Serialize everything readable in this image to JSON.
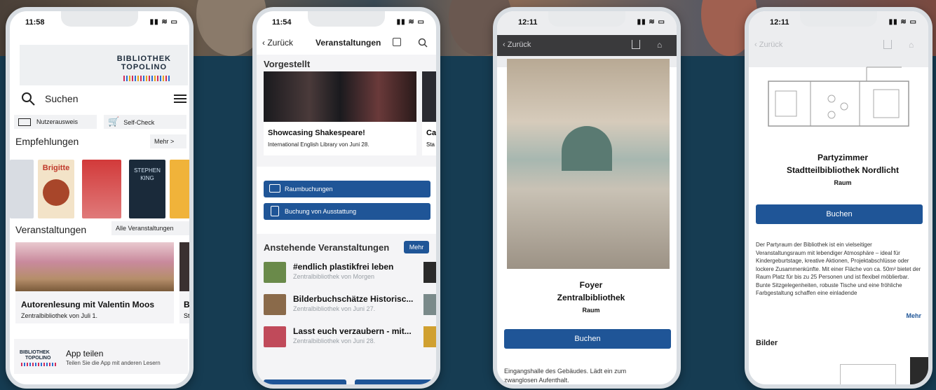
{
  "phone1": {
    "time": "11:58",
    "logo": {
      "line1": "BIBLIOTHEK",
      "line2": "TOPOLINO"
    },
    "search_label": "Suchen",
    "buttons": {
      "card": "Nutzerausweis",
      "selfcheck": "Self-Check"
    },
    "recommendations": {
      "title": "Empfehlungen",
      "more": "Mehr >"
    },
    "books": [
      {
        "title": "Brigitte",
        "color": "#c8702c"
      },
      {
        "title": "STEPHEN KING",
        "color": "#1a2a3a"
      }
    ],
    "events": {
      "title": "Veranstaltungen",
      "all": "Alle Veranstaltungen"
    },
    "event_card": {
      "title": "Autorenlesung mit Valentin Moos",
      "subtitle": "Zentralbibliothek von Juli 1.",
      "next_initial": "B",
      "next_sub": "St"
    },
    "share": {
      "logo1": "BIBLIOTHEK",
      "logo2": "TOPOLINO",
      "title": "App teilen",
      "subtitle": "Teilen Sie die App mit anderen Lesern"
    }
  },
  "phone2": {
    "time": "11:54",
    "back": "Zurück",
    "title": "Veranstaltungen",
    "featured": "Vorgestellt",
    "featured_card": {
      "title": "Showcasing Shakespeare!",
      "subtitle": "International English Library von Juni 28.",
      "next_title": "Ca",
      "next_sub": "Sta"
    },
    "buttons": {
      "rooms": "Raumbuchungen",
      "equipment": "Buchung von Ausstattung"
    },
    "upcoming": {
      "title": "Anstehende Veranstaltungen",
      "more": "Mehr"
    },
    "items": [
      {
        "title": "#endlich plastikfrei leben",
        "subtitle": "Zentralbibliothek von Morgen"
      },
      {
        "title": "Bilderbuchschätze Historisc...",
        "subtitle": "Zentralbibliothek von Juni 27."
      },
      {
        "title": "Lasst euch verzaubern - mit...",
        "subtitle": "Zentralbibliothek von Juni 28."
      }
    ]
  },
  "phone3": {
    "time": "12:11",
    "back": "Zurück",
    "room_title1": "Foyer",
    "room_title2": "Zentralbibliothek",
    "kind": "Raum",
    "book_button": "Buchen",
    "description": "Eingangshalle des Gebäudes. Lädt ein zum zwanglosen Aufenthalt."
  },
  "phone4": {
    "time": "12:11",
    "back": "Zurück",
    "room_title1": "Partyzimmer",
    "room_title2": "Stadtteilbibliothek Nordlicht",
    "kind": "Raum",
    "book_button": "Buchen",
    "description": "Der Partyraum der Bibliothek ist ein vielseitiger Veranstaltungsraum mit lebendiger Atmosphäre – ideal für Kindergeburtstage, kreative Aktionen, Projektabschlüsse oder lockere Zusammenkünfte. Mit einer Fläche von ca. 50m² bietet der Raum Platz für bis zu 25 Personen und ist flexibel möblierbar. Bunte Sitzgelegenheiten, robuste Tische und eine fröhliche Farbgestaltung schaffen eine einladende",
    "more": "Mehr",
    "images_title": "Bilder"
  },
  "colors": {
    "accent": "#1f5597",
    "background": "#163c52"
  }
}
